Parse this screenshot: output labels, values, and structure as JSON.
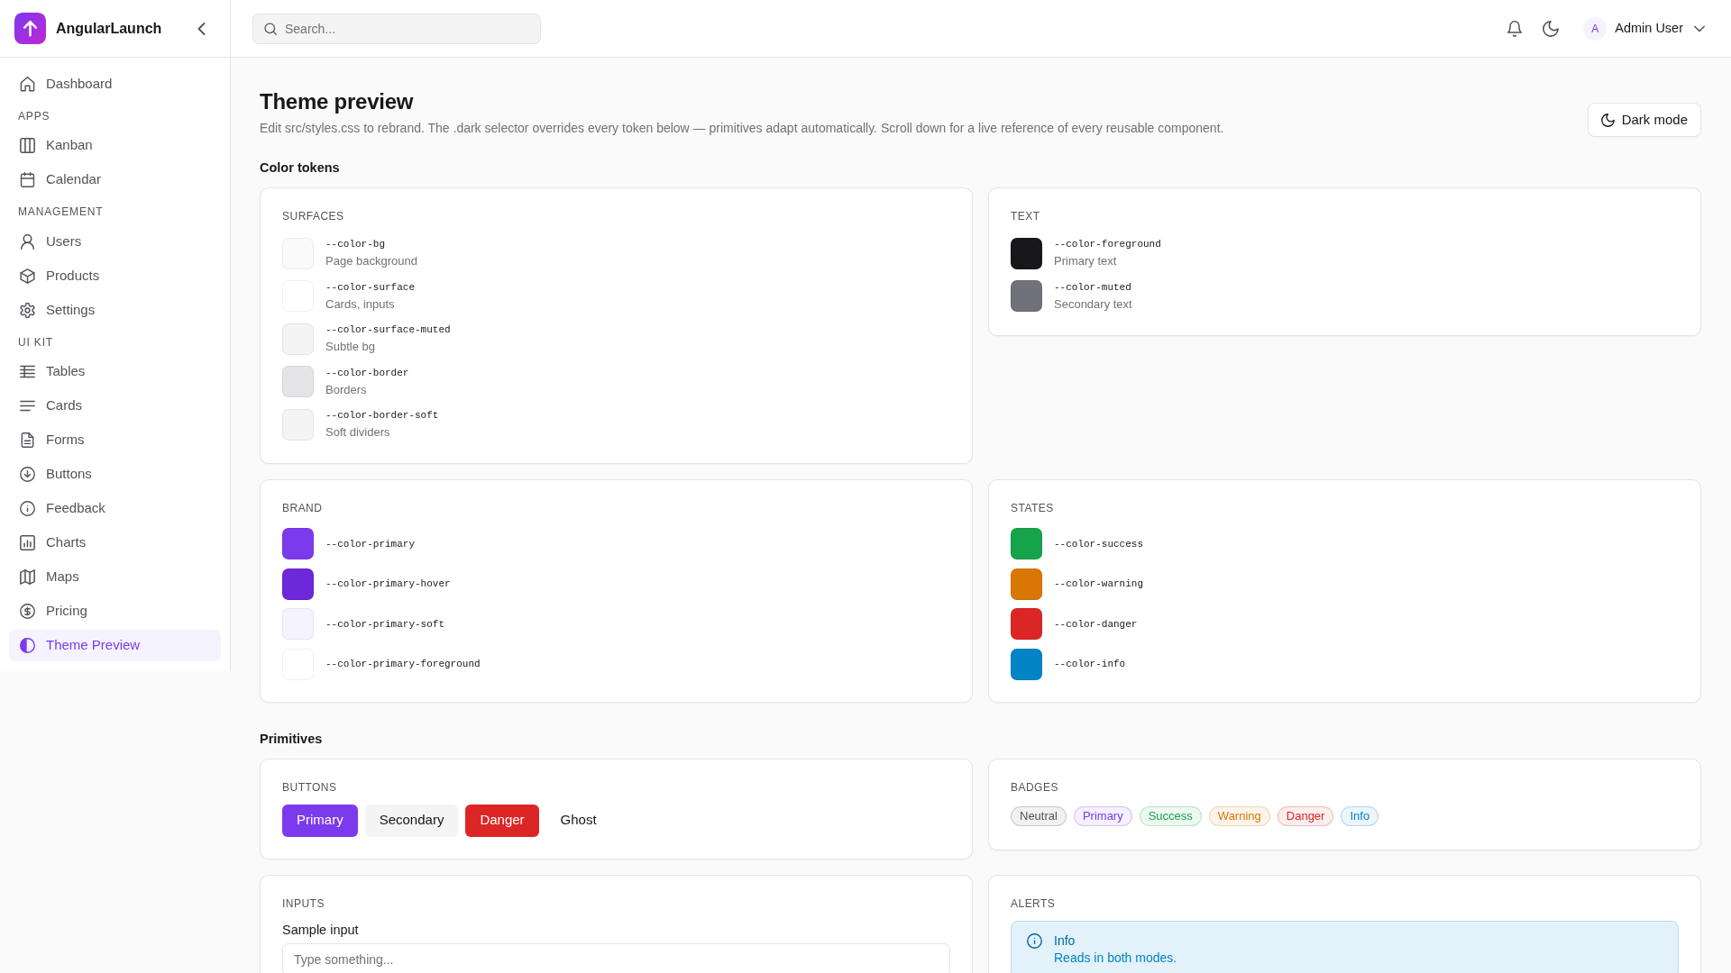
{
  "sidebar": {
    "brand": "AngularLaunch",
    "sections": [
      {
        "items": [
          {
            "label": "Dashboard",
            "selected": false
          }
        ]
      },
      {
        "heading": "APPS",
        "items": [
          {
            "label": "Kanban",
            "selected": false
          },
          {
            "label": "Calendar",
            "selected": false
          }
        ]
      },
      {
        "heading": "MANAGEMENT",
        "items": [
          {
            "label": "Users",
            "selected": false
          },
          {
            "label": "Products",
            "selected": false
          },
          {
            "label": "Settings",
            "selected": false
          }
        ]
      },
      {
        "heading": "UI KIT",
        "items": [
          {
            "label": "Tables",
            "selected": false
          },
          {
            "label": "Cards",
            "selected": false
          },
          {
            "label": "Forms",
            "selected": false
          },
          {
            "label": "Buttons",
            "selected": false
          },
          {
            "label": "Feedback",
            "selected": false
          },
          {
            "label": "Charts",
            "selected": false
          },
          {
            "label": "Maps",
            "selected": false
          },
          {
            "label": "Pricing",
            "selected": false
          },
          {
            "label": "Theme Preview",
            "selected": true
          }
        ]
      }
    ]
  },
  "top_bar": {
    "search": {
      "placeholder": "Search..."
    },
    "user": {
      "initial": "A",
      "name": "Admin User"
    }
  },
  "page": {
    "title": "Theme preview",
    "subtitle": "Edit src/styles.css to rebrand. The .dark selector overrides every token below — primitives adapt automatically. Scroll down for a live reference of every reusable component.",
    "button": "Dark mode"
  },
  "sections": [
    {
      "heading": "Color tokens",
      "cards": [
        {
          "kind": "tokens",
          "title": "SURFACES",
          "tokens": [
            {
              "name": "--color-bg",
              "description": "Page background",
              "color": "#fafafa"
            },
            {
              "name": "--color-surface",
              "description": "Cards, inputs",
              "color": "#ffffff"
            },
            {
              "name": "--color-surface-muted",
              "description": "Subtle bg",
              "color": "#f4f4f5"
            },
            {
              "name": "--color-border",
              "description": "Borders",
              "color": "#e4e4e7"
            },
            {
              "name": "--color-border-soft",
              "description": "Soft dividers",
              "color": "#f4f4f5"
            }
          ]
        },
        {
          "kind": "tokens",
          "title": "TEXT",
          "tokens": [
            {
              "name": "--color-foreground",
              "description": "Primary text",
              "color": "#18181b"
            },
            {
              "name": "--color-muted",
              "description": "Secondary text",
              "color": "#71717a"
            }
          ]
        },
        {
          "kind": "tokens",
          "title": "BRAND",
          "tokens": [
            {
              "name": "--color-primary",
              "color": "#7c3aed"
            },
            {
              "name": "--color-primary-hover",
              "color": "#6d28d9"
            },
            {
              "name": "--color-primary-soft",
              "color": "#f5f3ff"
            },
            {
              "name": "--color-primary-foreground",
              "color": "#ffffff"
            }
          ]
        },
        {
          "kind": "tokens",
          "title": "STATES",
          "tokens": [
            {
              "name": "--color-success",
              "color": "#16a34a"
            },
            {
              "name": "--color-warning",
              "color": "#d97706"
            },
            {
              "name": "--color-danger",
              "color": "#dc2626"
            },
            {
              "name": "--color-info",
              "color": "#0284c7"
            }
          ]
        }
      ]
    },
    {
      "heading": "Primitives",
      "cards": [
        {
          "kind": "buttons",
          "title": "BUTTONS",
          "buttons": [
            {
              "label": "Primary",
              "kind": "primary"
            },
            {
              "label": "Secondary",
              "kind": "secondary"
            },
            {
              "label": "Danger",
              "kind": "danger"
            },
            {
              "label": "Ghost",
              "kind": "ghost"
            }
          ]
        },
        {
          "kind": "badges",
          "title": "BADGES",
          "badges": [
            {
              "label": "Neutral",
              "color": "#52525b"
            },
            {
              "label": "Primary",
              "color": "#7c3aed"
            },
            {
              "label": "Success",
              "color": "#16a34a"
            },
            {
              "label": "Warning",
              "color": "#d97706"
            },
            {
              "label": "Danger",
              "color": "#dc2626"
            },
            {
              "label": "Info",
              "color": "#0284c7"
            }
          ]
        },
        {
          "kind": "inputs",
          "title": "INPUTS",
          "fields": [
            {
              "label": "Sample input",
              "placeholder": "Type something..."
            }
          ]
        },
        {
          "kind": "alerts",
          "title": "ALERTS",
          "alerts": [
            {
              "kind": "info",
              "title": "Info",
              "text": "Reads in both modes."
            }
          ]
        }
      ]
    }
  ]
}
